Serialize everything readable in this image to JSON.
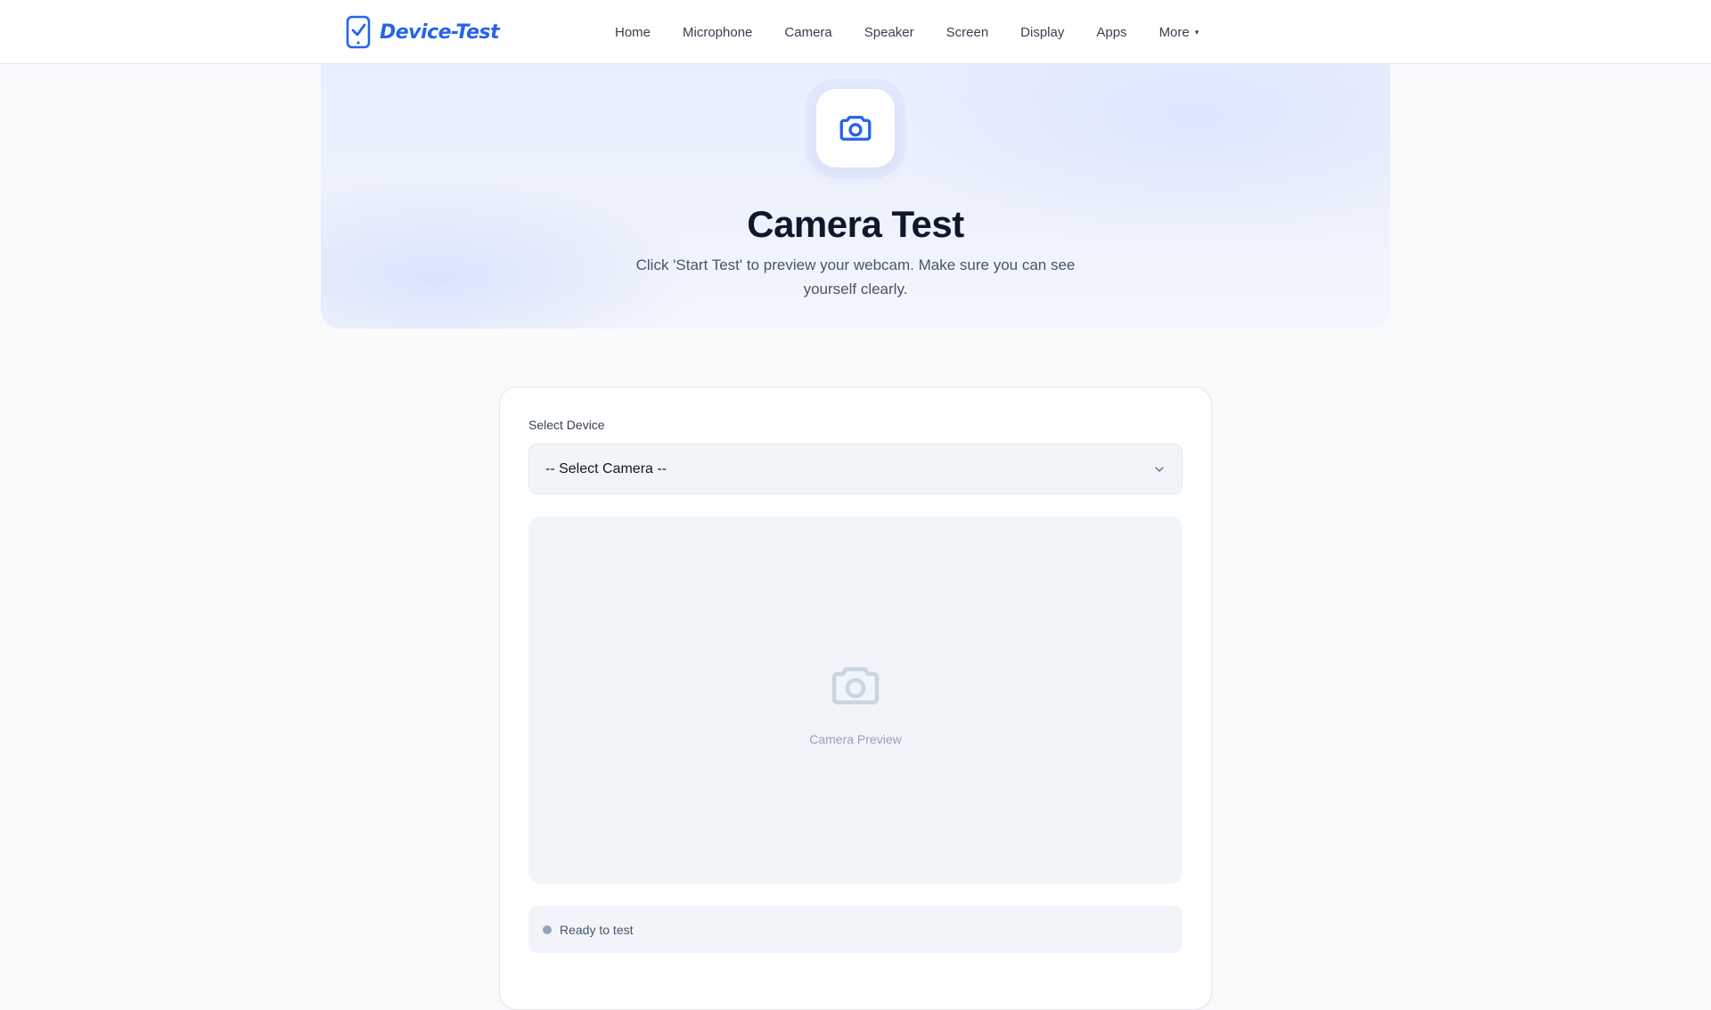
{
  "header": {
    "brand": "Device-Test",
    "nav": [
      {
        "label": "Home"
      },
      {
        "label": "Microphone"
      },
      {
        "label": "Camera"
      },
      {
        "label": "Speaker"
      },
      {
        "label": "Screen"
      },
      {
        "label": "Display"
      },
      {
        "label": "Apps"
      },
      {
        "label": "More"
      }
    ]
  },
  "hero": {
    "icon": "camera-icon",
    "title": "Camera Test",
    "subtitle": "Click 'Start Test' to preview your webcam. Make sure you can see yourself clearly."
  },
  "card": {
    "device_label": "Select Device",
    "select_value": "-- Select Camera --",
    "preview_label": "Camera Preview",
    "status_text": "Ready to test"
  },
  "colors": {
    "accent": "#2563eb",
    "text": "#0f172a",
    "muted": "#94a3b8",
    "status_idle": "#94a3b8"
  }
}
